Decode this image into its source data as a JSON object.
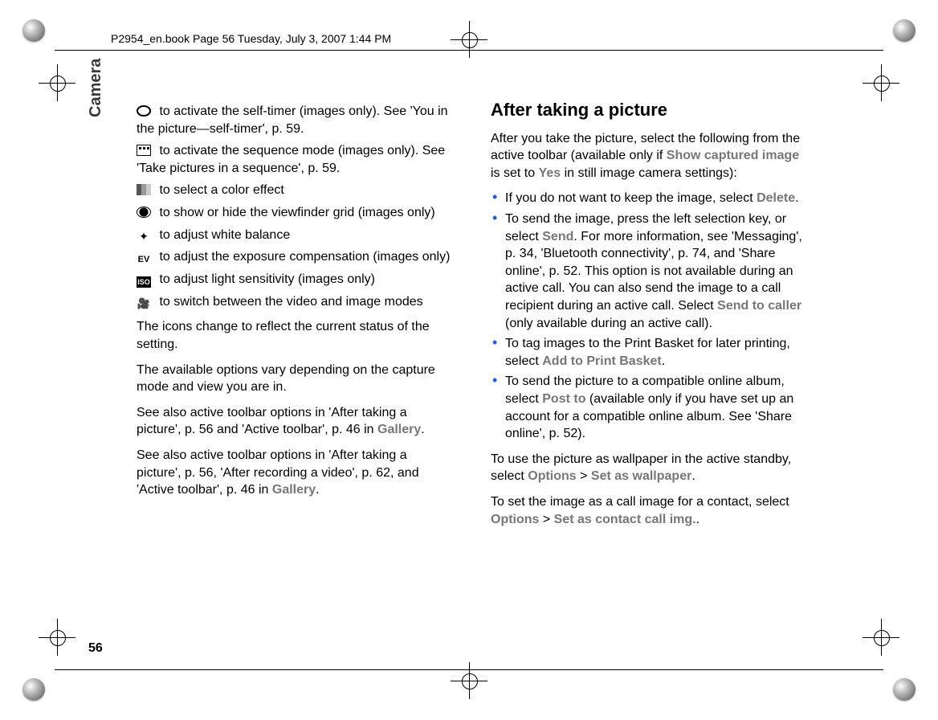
{
  "header": "P2954_en.book  Page 56  Tuesday, July 3, 2007  1:44 PM",
  "side_label": "Camera",
  "page_number": "56",
  "left": {
    "l1a": "  to activate the self-timer (images only). See 'You in the picture—self-timer', p. 59.",
    "l2a": "  to activate the sequence mode (images only). See 'Take pictures in a sequence', p. 59.",
    "l3": "  to select a color effect",
    "l4": "  to show or hide the viewfinder grid (images only)",
    "l5": "  to adjust white balance",
    "l6": "  to adjust the exposure compensation (images only)",
    "l7": "  to adjust light sensitivity (images only)",
    "l8": "  to switch between the video and image modes",
    "p1": "The icons change to reflect the current status of the setting.",
    "p2": "The available options vary depending on the capture mode and view you are in.",
    "p3a": "See also active toolbar options in 'After taking a picture', p. 56 and 'Active toolbar', p. 46 in ",
    "p3g": "Gallery",
    "p3b": ".",
    "p4a": "See also active toolbar options in 'After taking a picture', p. 56, 'After recording a video', p. 62, and 'Active toolbar', p. 46 in ",
    "p4g": "Gallery",
    "p4b": "."
  },
  "right": {
    "heading": "After taking a picture",
    "intro_a": "After you take the picture, select the following from the active toolbar (available only if ",
    "intro_g1": "Show captured image",
    "intro_b": " is set to ",
    "intro_g2": "Yes",
    "intro_c": " in still image camera settings):",
    "b1a": "If you do not want to keep the image, select ",
    "b1g": "Delete",
    "b1b": ".",
    "b2a": "To send the image, press the left selection key, or select ",
    "b2g": "Send",
    "b2b": ". For more information, see 'Messaging', p. 34, 'Bluetooth connectivity', p. 74, and 'Share online', p. 52. This option is not available during an active call. You can also send the image to a call recipient during an active call. Select ",
    "b2g2": "Send to caller",
    "b2c": " (only available during an active call).",
    "b3a": "To tag images to the Print Basket for later printing, select ",
    "b3g": "Add to Print Basket",
    "b3b": ".",
    "b4a": "To send the picture to a compatible online album, select ",
    "b4g": "Post to",
    "b4b": "  (available only if you have set up an account for a compatible online album. See 'Share online', p. 52).",
    "p5a": "To use the picture as wallpaper in the active standby, select ",
    "p5g1": "Options",
    "p5b": " > ",
    "p5g2": "Set as wallpaper",
    "p5c": ".",
    "p6a": "To set the image as a call image for a contact, select ",
    "p6g1": "Options",
    "p6b": " > ",
    "p6g2": "Set as contact call img.",
    "p6c": "."
  }
}
